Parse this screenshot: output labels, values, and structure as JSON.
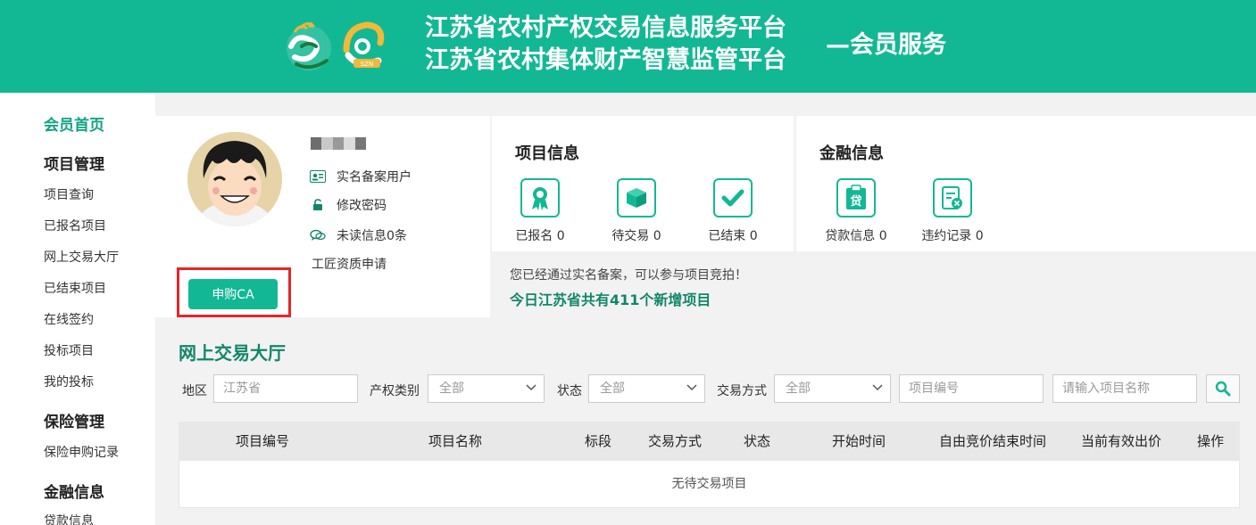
{
  "header": {
    "title_line1": "江苏省农村产权交易信息服务平台",
    "title_line2": "江苏省农村集体财产智慧监管平台",
    "title_suffix": "—会员服务",
    "logo2_text": "SZN"
  },
  "sidebar": {
    "home": "会员首页",
    "groups": [
      {
        "title": "项目管理",
        "items": [
          "项目查询",
          "已报名项目",
          "网上交易大厅",
          "已结束项目",
          "在线签约",
          "投标项目",
          "我的投标"
        ]
      },
      {
        "title": "保险管理",
        "items": [
          "保险申购记录"
        ]
      },
      {
        "title": "金融信息",
        "items": [
          "贷款信息"
        ]
      }
    ]
  },
  "profile": {
    "verified": "实名备案用户",
    "change_password": "修改密码",
    "unread": "未读信息0条",
    "craftsman": "工匠资质申请",
    "ca_button": "申购CA"
  },
  "project_info": {
    "title": "项目信息",
    "stats": [
      {
        "icon": "ribbon-icon",
        "label": "已报名 0"
      },
      {
        "icon": "box-icon",
        "label": "待交易 0"
      },
      {
        "icon": "check-icon",
        "label": "已结束 0"
      }
    ]
  },
  "finance_info": {
    "title": "金融信息",
    "stats": [
      {
        "icon": "loan-icon",
        "label": "贷款信息 0"
      },
      {
        "icon": "breach-record-icon",
        "label": "违约记录 0"
      }
    ]
  },
  "notice": {
    "line1": "您已经通过实名备案，可以参与项目竞拍！",
    "line2": "今日江苏省共有411个新增项目"
  },
  "hall": {
    "title": "网上交易大厅",
    "filters": {
      "region_label": "地区",
      "region_placeholder": "江苏省",
      "category_label": "产权类别",
      "category_value": "全部",
      "status_label": "状态",
      "status_value": "全部",
      "trade_label": "交易方式",
      "trade_value": "全部",
      "code_placeholder": "项目编号",
      "name_placeholder": "请输入项目名称"
    },
    "columns": [
      "项目编号",
      "项目名称",
      "标段",
      "交易方式",
      "状态",
      "开始时间",
      "自由竞价结束时间",
      "当前有效出价",
      "操作"
    ],
    "empty_text": "无待交易项目"
  },
  "colors": {
    "brand": "#12b893",
    "brand_dark": "#12866b",
    "highlight_border": "#e5252a"
  }
}
